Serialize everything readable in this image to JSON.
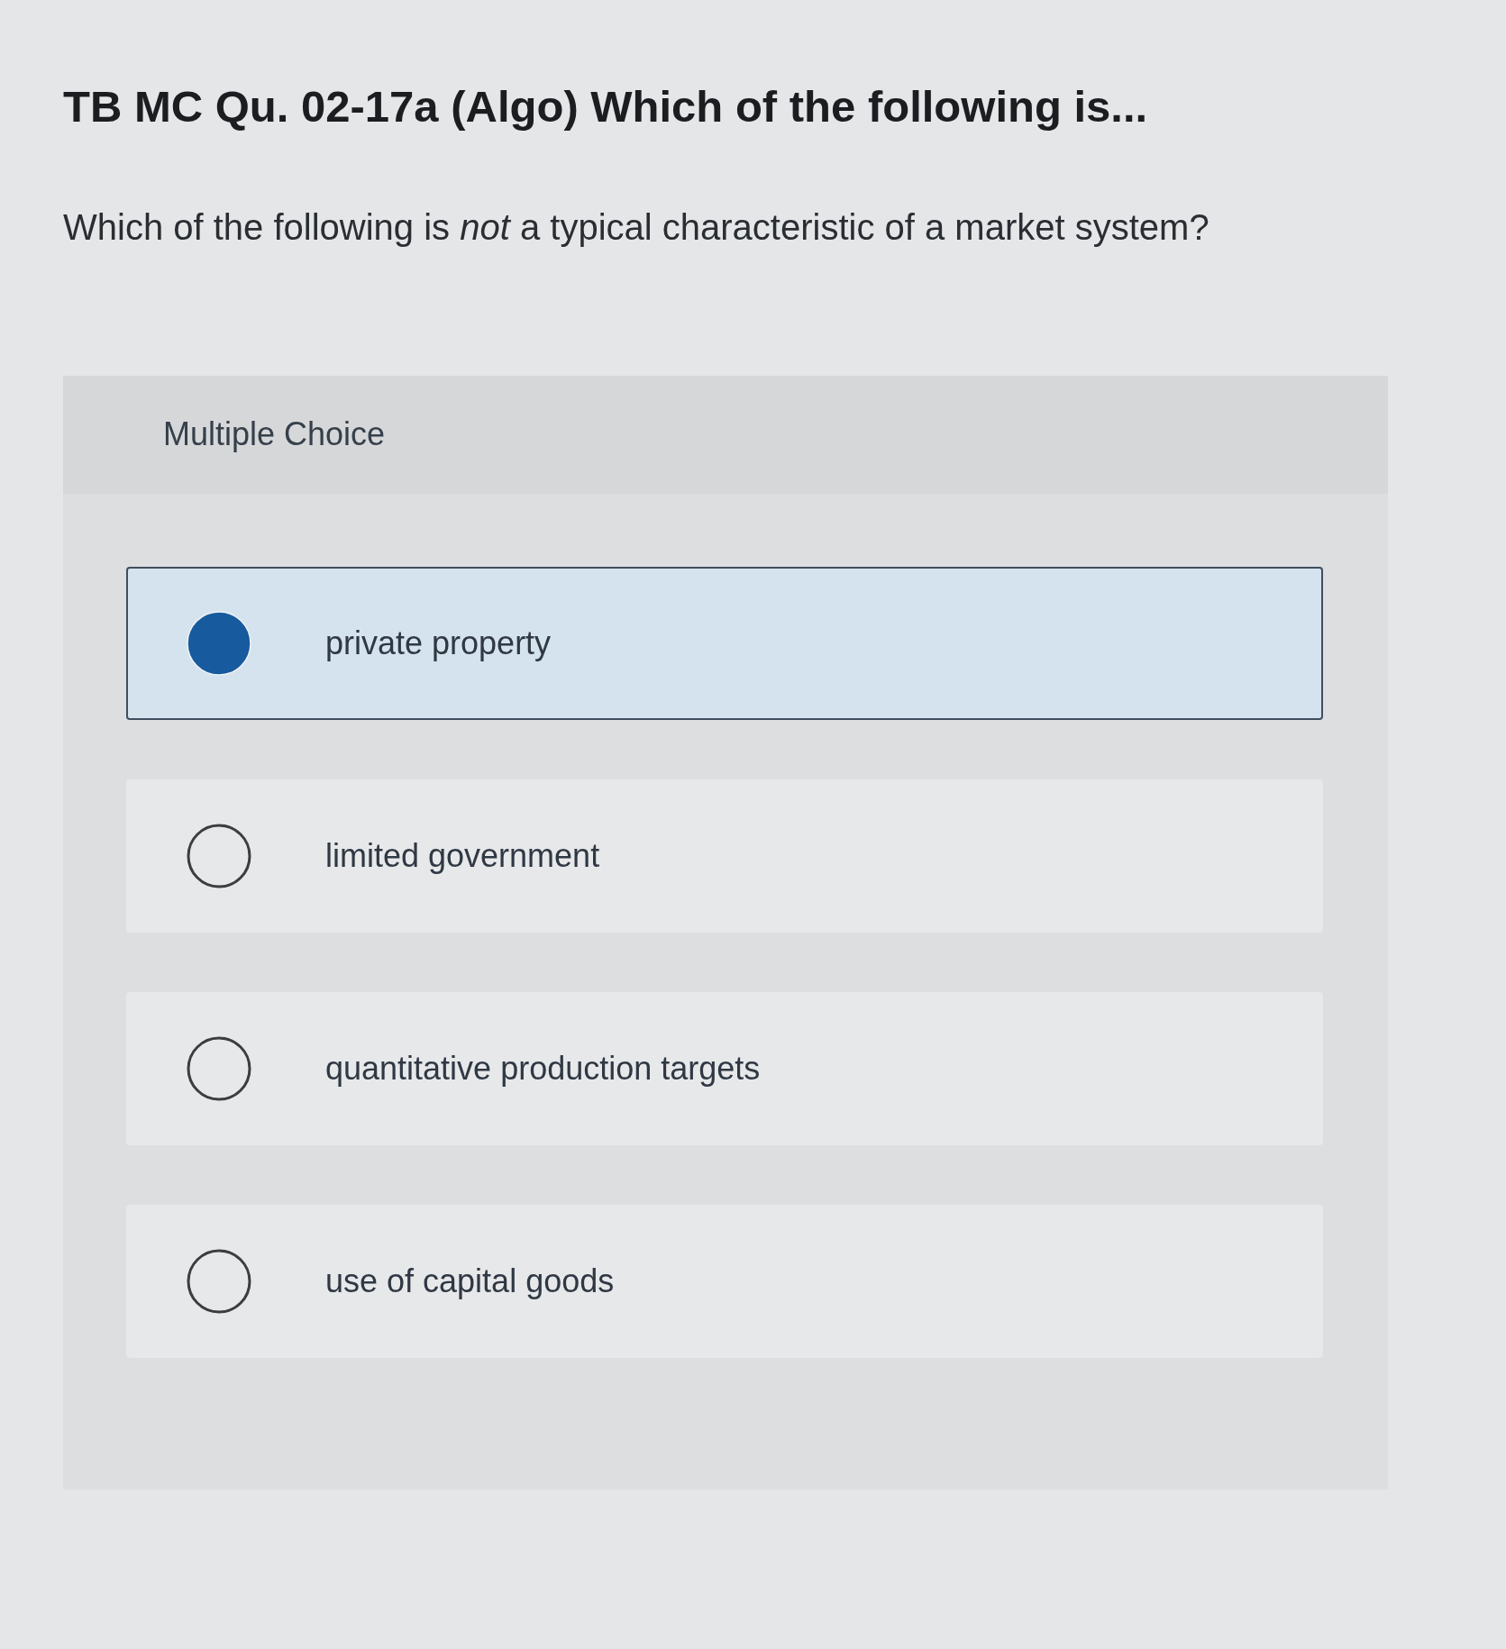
{
  "title": "TB MC Qu. 02-17a (Algo) Which of the following is...",
  "question": "Which of the following is *not* a typical characteristic of a market system?",
  "answer_panel": {
    "heading": "Multiple Choice",
    "options": [
      {
        "label": "private property",
        "selected": true
      },
      {
        "label": "limited government",
        "selected": false
      },
      {
        "label": "quantitative production targets",
        "selected": false
      },
      {
        "label": "use of capital goods",
        "selected": false
      }
    ]
  }
}
